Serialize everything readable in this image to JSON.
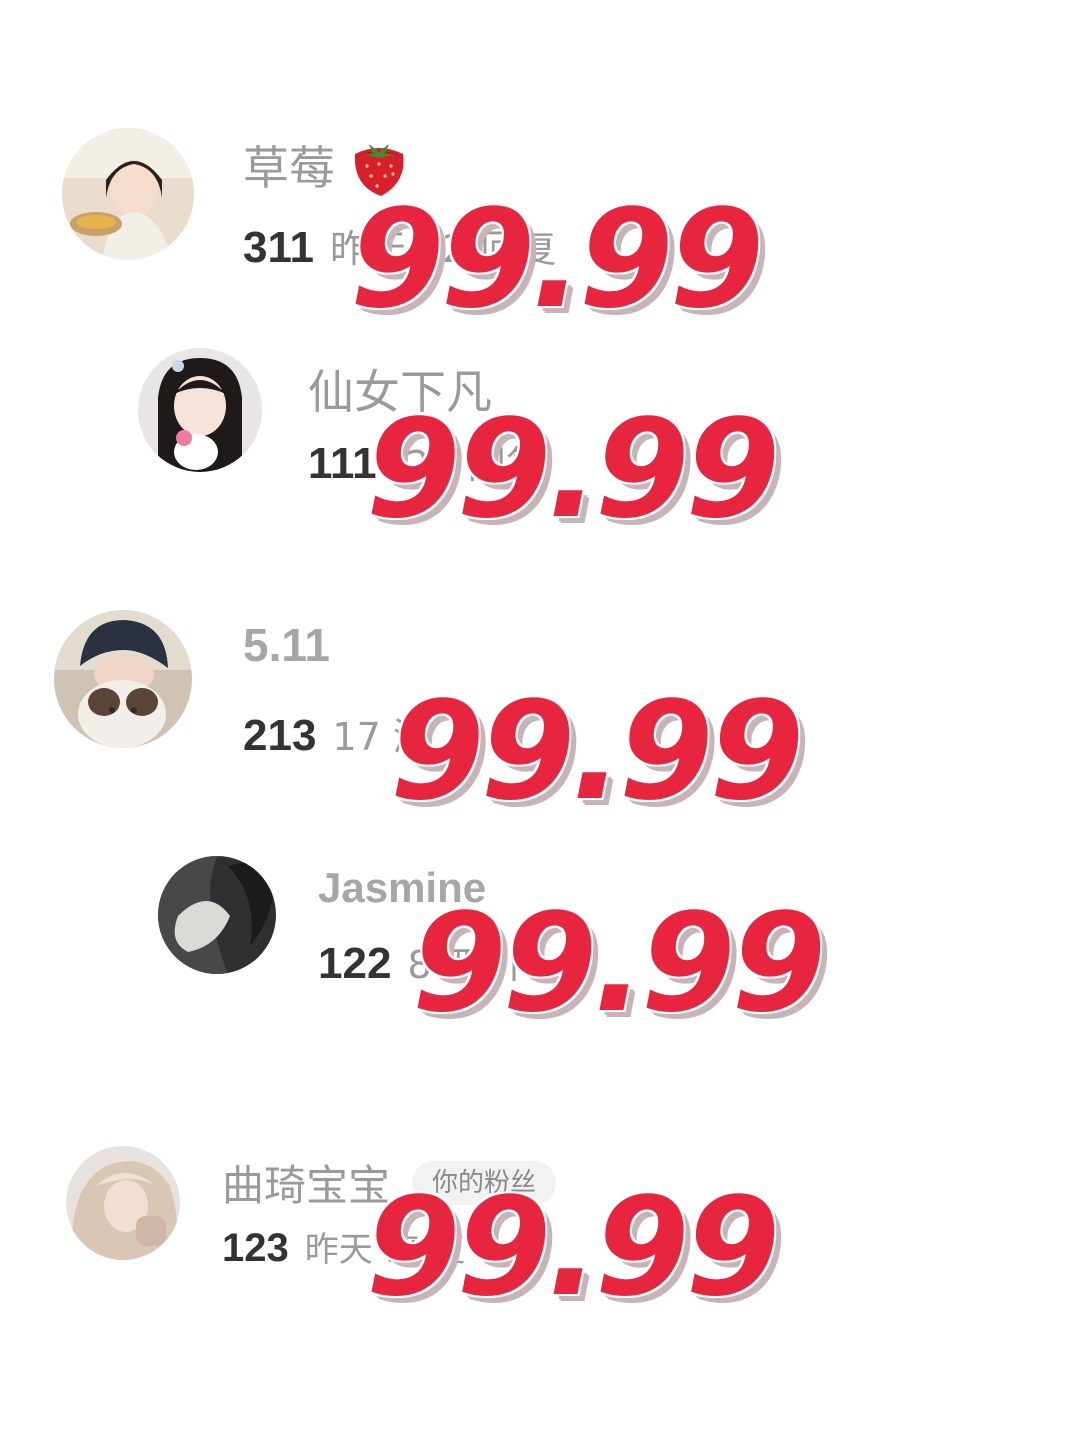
{
  "comments": [
    {
      "username": "草莓",
      "emoji": "strawberry-emoji",
      "likes": "311",
      "meta": "昨天 12",
      "reply": "回复",
      "price": "99.99"
    },
    {
      "username": "仙女下凡",
      "likes": "111",
      "meta": ":25",
      "reply": "回复",
      "price": "99.99"
    },
    {
      "username": "5.11",
      "likes": "213",
      "meta": "17 浙",
      "reply": "",
      "price": "99.99"
    },
    {
      "username": "Jasmine",
      "likes": "122",
      "meta": "8 四川",
      "reply": "",
      "price": "99.99"
    },
    {
      "username": "曲琦宝宝",
      "badge": "你的粉丝",
      "likes": "123",
      "meta": "昨天",
      "reply": "来 复",
      "price": "99.99"
    }
  ],
  "colors": {
    "overlay_red": "#e8253f",
    "username_gray": "#9a9a9a",
    "likes_dark": "#333333",
    "badge_bg": "#f2f2f2"
  }
}
